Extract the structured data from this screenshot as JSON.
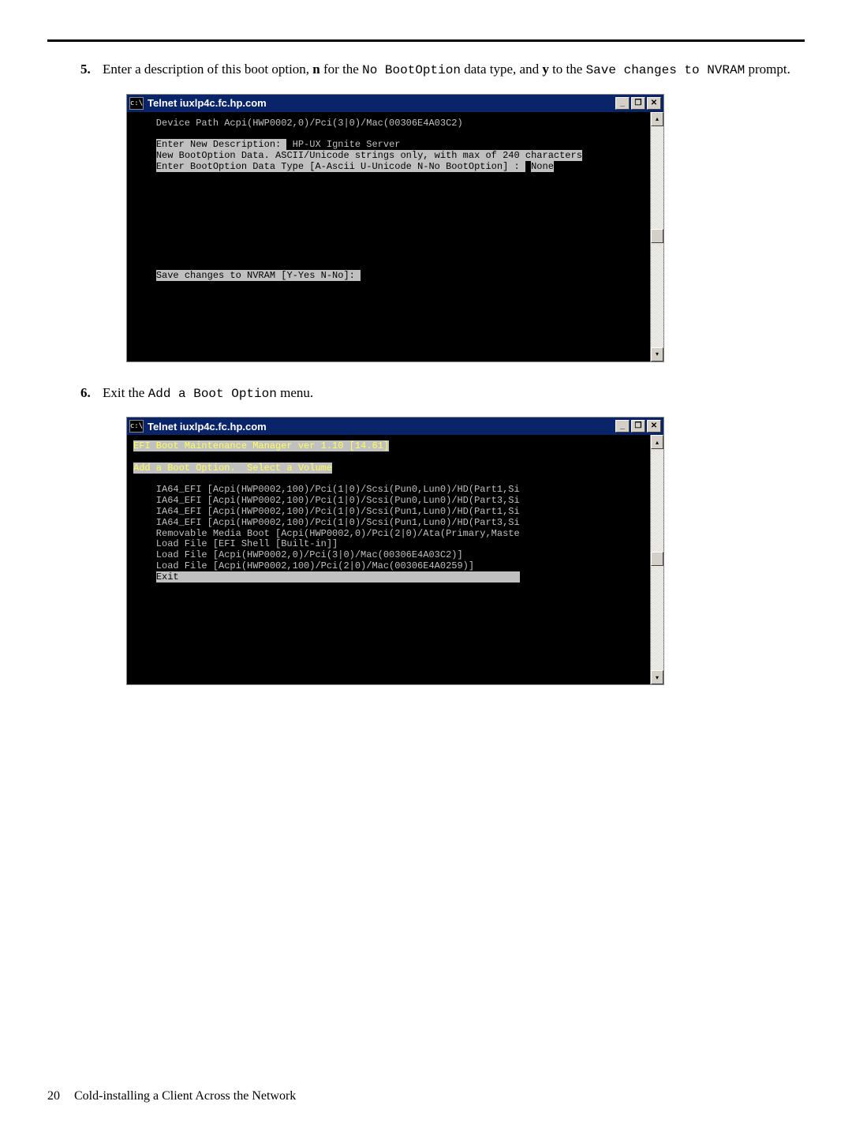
{
  "step5": {
    "num": "5.",
    "t1": "Enter a description of this boot option, ",
    "b1": "n",
    "t2": " for the ",
    "m1": "No BootOption",
    "t3": " data type, and ",
    "b2": "y",
    "t4": " to the ",
    "m2": "Save changes to NVRAM",
    "t5": " prompt."
  },
  "step6": {
    "num": "6.",
    "t1": "Exit the ",
    "m1": "Add a Boot Option",
    "t2": " menu."
  },
  "win1": {
    "icon": "c:\\",
    "title": "Telnet iuxlp4c.fc.hp.com",
    "min": "_",
    "max": "❐",
    "close": "✕",
    "up": "▴",
    "down": "▾",
    "term_pre": "    Device Path Acpi(HWP0002,0)/Pci(3|0)/Mac(00306E4A03C2)\n\n    ",
    "hl1": "Enter New Description: ",
    "hl1_after": " HP-UX Ignite Server\n    ",
    "hl2": "New BootOption Data. ASCII/Unicode strings only, with max of 240 characters",
    "hl3_pre": "\n    ",
    "hl3": "Enter BootOption Data Type [A-Ascii U-Unicode N-No BootOption] : ",
    "hl3_after": " ",
    "hl3_val": "None",
    "blank": "\n\n\n\n\n\n\n\n\n\n    ",
    "hl4": "Save changes to NVRAM [Y-Yes N-No]: ",
    "tail": "\n\n\n\n\n"
  },
  "win2": {
    "icon": "c:\\",
    "title": "Telnet iuxlp4c.fc.hp.com",
    "min": "_",
    "max": "❐",
    "close": "✕",
    "up": "▴",
    "down": "▾",
    "yel1": "EFI Boot Maintenance Manager ver 1.10 [14.61]",
    "yel2": "Add a Boot Option.  Select a Volume",
    "lines": "\n\n    IA64_EFI [Acpi(HWP0002,100)/Pci(1|0)/Scsi(Pun0,Lun0)/HD(Part1,Si\n    IA64_EFI [Acpi(HWP0002,100)/Pci(1|0)/Scsi(Pun0,Lun0)/HD(Part3,Si\n    IA64_EFI [Acpi(HWP0002,100)/Pci(1|0)/Scsi(Pun1,Lun0)/HD(Part1,Si\n    IA64_EFI [Acpi(HWP0002,100)/Pci(1|0)/Scsi(Pun1,Lun0)/HD(Part3,Si\n    Removable Media Boot [Acpi(HWP0002,0)/Pci(2|0)/Ata(Primary,Maste\n    Load File [EFI Shell [Built-in]]\n    Load File [Acpi(HWP0002,0)/Pci(3|0)/Mac(00306E4A03C2)]\n    Load File [Acpi(HWP0002,100)/Pci(2|0)/Mac(00306E4A0259)]\n    ",
    "exit": "Exit                                                            ",
    "tail": "\n\n\n\n\n\n\n\n\n\n"
  },
  "footer": {
    "page": "20",
    "text": "Cold-installing a Client Across the Network"
  }
}
